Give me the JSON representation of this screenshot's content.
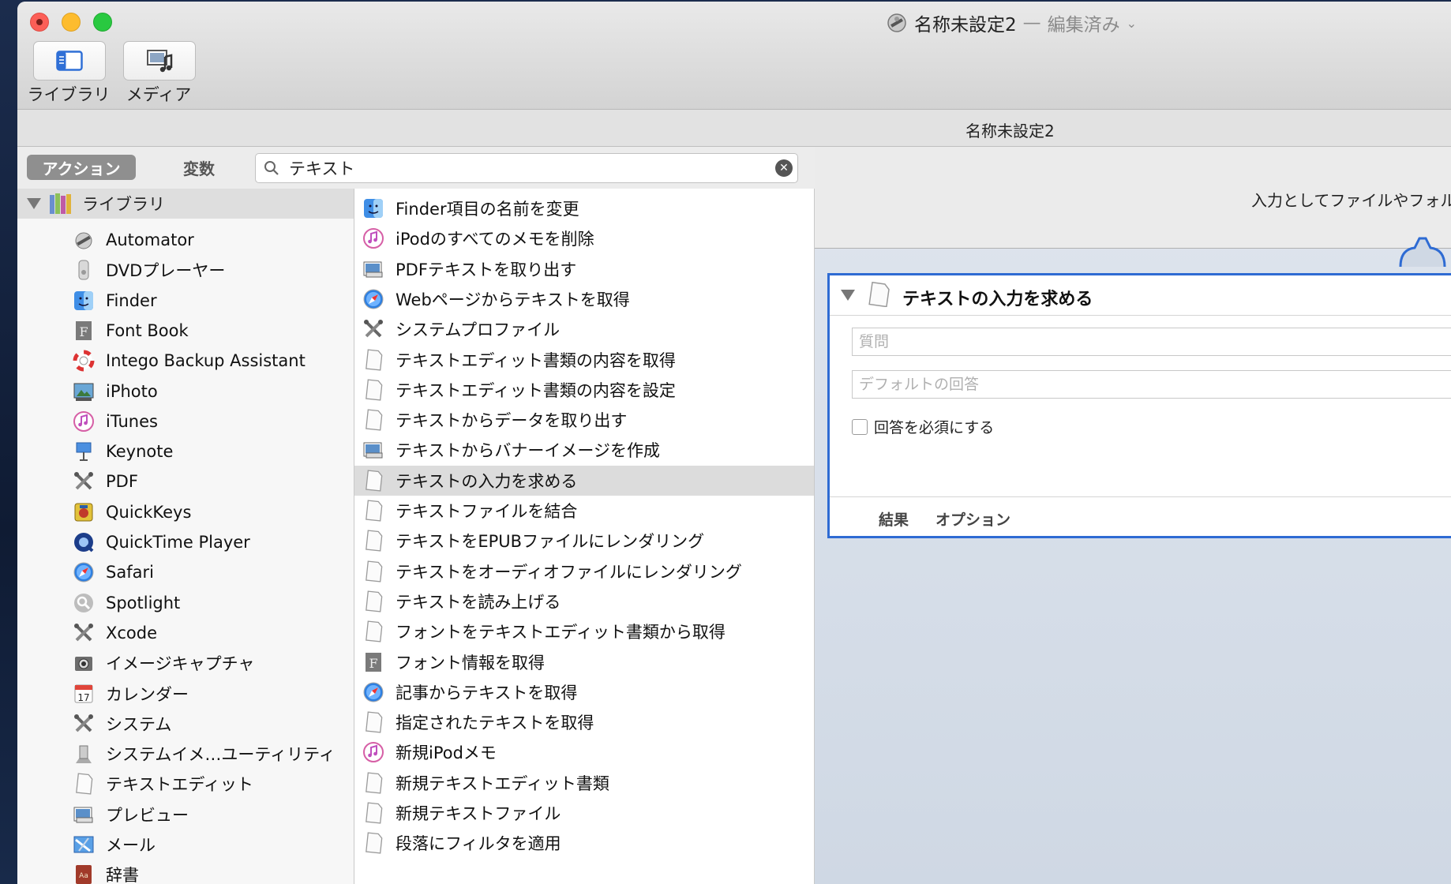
{
  "window": {
    "title": "名称未設定2",
    "title_separator": "—",
    "title_status": "編集済み",
    "document_name": "名称未設定2"
  },
  "toolbar": {
    "library_label": "ライブラリ",
    "media_label": "メディア"
  },
  "library_pane": {
    "tab_actions": "アクション",
    "tab_variables": "変数",
    "search_value": "テキスト",
    "library_header": "ライブラリ",
    "categories": [
      {
        "label": "Automator",
        "icon": "automator-icon"
      },
      {
        "label": "DVDプレーヤー",
        "icon": "dvd-player-icon"
      },
      {
        "label": "Finder",
        "icon": "finder-icon"
      },
      {
        "label": "Font Book",
        "icon": "font-book-icon"
      },
      {
        "label": "Intego Backup Assistant",
        "icon": "lifebuoy-icon"
      },
      {
        "label": "iPhoto",
        "icon": "iphoto-icon"
      },
      {
        "label": "iTunes",
        "icon": "itunes-icon"
      },
      {
        "label": "Keynote",
        "icon": "keynote-icon"
      },
      {
        "label": "PDF",
        "icon": "tools-icon"
      },
      {
        "label": "QuickKeys",
        "icon": "quickkeys-icon"
      },
      {
        "label": "QuickTime Player",
        "icon": "quicktime-icon"
      },
      {
        "label": "Safari",
        "icon": "safari-icon"
      },
      {
        "label": "Spotlight",
        "icon": "spotlight-icon"
      },
      {
        "label": "Xcode",
        "icon": "tools-icon"
      },
      {
        "label": "イメージキャプチャ",
        "icon": "image-capture-icon"
      },
      {
        "label": "カレンダー",
        "icon": "calendar-icon"
      },
      {
        "label": "システム",
        "icon": "tools-icon"
      },
      {
        "label": "システムイメ…ユーティリティ",
        "icon": "system-image-icon"
      },
      {
        "label": "テキストエディット",
        "icon": "document-icon"
      },
      {
        "label": "プレビュー",
        "icon": "preview-icon"
      },
      {
        "label": "メール",
        "icon": "mail-icon"
      },
      {
        "label": "辞書",
        "icon": "dictionary-icon"
      }
    ],
    "calendar_day": "17",
    "actions": [
      {
        "label": "Finder項目の名前を変更",
        "icon": "finder-icon"
      },
      {
        "label": "iPodのすべてのメモを削除",
        "icon": "itunes-icon"
      },
      {
        "label": "PDFテキストを取り出す",
        "icon": "preview-icon"
      },
      {
        "label": "Webページからテキストを取得",
        "icon": "safari-icon"
      },
      {
        "label": "システムプロファイル",
        "icon": "tools-icon"
      },
      {
        "label": "テキストエディット書類の内容を取得",
        "icon": "document-icon"
      },
      {
        "label": "テキストエディット書類の内容を設定",
        "icon": "document-icon"
      },
      {
        "label": "テキストからデータを取り出す",
        "icon": "document-icon"
      },
      {
        "label": "テキストからバナーイメージを作成",
        "icon": "preview-icon"
      },
      {
        "label": "テキストの入力を求める",
        "icon": "document-icon",
        "selected": true
      },
      {
        "label": "テキストファイルを結合",
        "icon": "document-icon"
      },
      {
        "label": "テキストをEPUBファイルにレンダリング",
        "icon": "document-icon"
      },
      {
        "label": "テキストをオーディオファイルにレンダリング",
        "icon": "document-icon"
      },
      {
        "label": "テキストを読み上げる",
        "icon": "document-icon"
      },
      {
        "label": "フォントをテキストエディット書類から取得",
        "icon": "document-icon"
      },
      {
        "label": "フォント情報を取得",
        "icon": "font-book-icon"
      },
      {
        "label": "記事からテキストを取得",
        "icon": "safari-icon"
      },
      {
        "label": "指定されたテキストを取得",
        "icon": "document-icon"
      },
      {
        "label": "新規iPodメモ",
        "icon": "itunes-icon"
      },
      {
        "label": "新規テキストエディット書類",
        "icon": "document-icon"
      },
      {
        "label": "新規テキストファイル",
        "icon": "document-icon"
      },
      {
        "label": "段落にフィルタを適用",
        "icon": "document-icon"
      }
    ]
  },
  "workflow": {
    "input_description": "入力としてファイルやフォルタ",
    "action": {
      "title": "テキストの入力を求める",
      "question_placeholder": "質問",
      "default_answer_placeholder": "デフォルトの回答",
      "require_answer_label": "回答を必須にする",
      "require_answer_checked": false,
      "footer_results": "結果",
      "footer_options": "オプション"
    }
  },
  "colors": {
    "selection_border": "#2e6bd3",
    "selected_row": "#dcdcdc",
    "segment_active": "#8f8f8f"
  }
}
